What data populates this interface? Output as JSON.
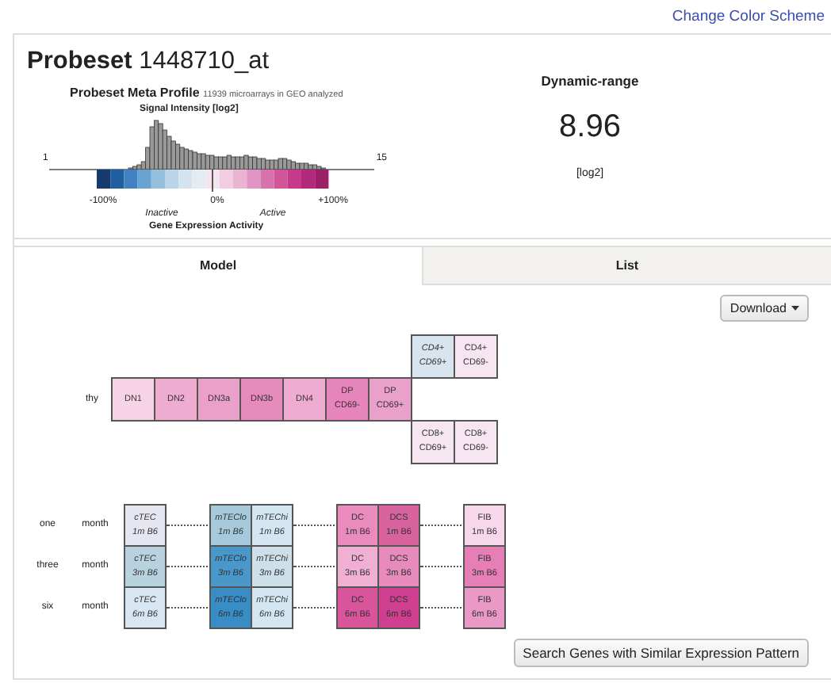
{
  "link": "Change Color Scheme",
  "probeset": {
    "label": "Probeset",
    "id": "1448710_at"
  },
  "meta_profile": {
    "title": "Probeset Meta Profile",
    "subtitle": "11939 microarrays in GEO analyzed",
    "histogram_title": "Signal Intensity [log2]",
    "axis_min": "1",
    "axis_max": "15",
    "scale_labels": [
      "-100%",
      "0%",
      "+100%"
    ],
    "inactive": "Inactive",
    "active": "Active",
    "caption": "Gene Expression Activity"
  },
  "dynamic_range": {
    "title": "Dynamic-range",
    "value": "8.96",
    "unit": "[log2]"
  },
  "tabs": [
    {
      "label": "Model",
      "selected": true
    },
    {
      "label": "List",
      "selected": false
    }
  ],
  "download": "Download",
  "thymus": {
    "label": "thy",
    "upper": [
      {
        "lines": [
          "CD4+",
          "CD69+"
        ],
        "italic": true,
        "color": "#d8e5ee"
      },
      {
        "lines": [
          "CD4+",
          "CD69-"
        ],
        "italic": false,
        "color": "#f6e6f1"
      }
    ],
    "main": [
      {
        "lines": [
          "DN1"
        ],
        "italic": false,
        "color": "#f7d3e6"
      },
      {
        "lines": [
          "DN2"
        ],
        "italic": false,
        "color": "#eeadd0"
      },
      {
        "lines": [
          "DN3a"
        ],
        "italic": false,
        "color": "#eaa1c9"
      },
      {
        "lines": [
          "DN3b"
        ],
        "italic": false,
        "color": "#e68bbb"
      },
      {
        "lines": [
          "DN4"
        ],
        "italic": false,
        "color": "#eeadd0"
      },
      {
        "lines": [
          "DP",
          "CD69-"
        ],
        "italic": false,
        "color": "#e685bb"
      },
      {
        "lines": [
          "DP",
          "CD69+"
        ],
        "italic": false,
        "color": "#eaa1c9"
      }
    ],
    "lower": [
      {
        "lines": [
          "CD8+",
          "CD69+"
        ],
        "italic": false,
        "color": "#f6e6f1"
      },
      {
        "lines": [
          "CD8+",
          "CD69-"
        ],
        "italic": false,
        "color": "#f6e6f1"
      }
    ]
  },
  "stroma": [
    {
      "label": "one",
      "unit": "month",
      "groups": [
        [
          {
            "lines": [
              "cTEC",
              "1m B6"
            ],
            "italic": true,
            "color": "#e6e6f0"
          }
        ],
        [
          {
            "lines": [
              "mTEClo",
              "1m B6"
            ],
            "italic": true,
            "color": "#a7c9dc"
          },
          {
            "lines": [
              "mTEChi",
              "1m B6"
            ],
            "italic": true,
            "color": "#d4e6f2"
          }
        ],
        [
          {
            "lines": [
              "DC",
              "1m B6"
            ],
            "italic": false,
            "color": "#e98bbd"
          },
          {
            "lines": [
              "DCS",
              "1m B6"
            ],
            "italic": false,
            "color": "#d8649f"
          }
        ],
        [
          {
            "lines": [
              "FIB",
              "1m B6"
            ],
            "italic": false,
            "color": "#f7d7ea"
          }
        ]
      ]
    },
    {
      "label": "three",
      "unit": "month",
      "groups": [
        [
          {
            "lines": [
              "cTEC",
              "3m B6"
            ],
            "italic": true,
            "color": "#b8d2e0"
          }
        ],
        [
          {
            "lines": [
              "mTEClo",
              "3m B6"
            ],
            "italic": true,
            "color": "#4a97c9"
          },
          {
            "lines": [
              "mTEChi",
              "3m B6"
            ],
            "italic": true,
            "color": "#cddfe8"
          }
        ],
        [
          {
            "lines": [
              "DC",
              "3m B6"
            ],
            "italic": false,
            "color": "#efb0d3"
          },
          {
            "lines": [
              "DCS",
              "3m B6"
            ],
            "italic": false,
            "color": "#e68bbb"
          }
        ],
        [
          {
            "lines": [
              "FIB",
              "3m B6"
            ],
            "italic": false,
            "color": "#e67fb5"
          }
        ]
      ]
    },
    {
      "label": "six",
      "unit": "month",
      "groups": [
        [
          {
            "lines": [
              "cTEC",
              "6m B6"
            ],
            "italic": true,
            "color": "#d7e6f0"
          }
        ],
        [
          {
            "lines": [
              "mTEClo",
              "6m B6"
            ],
            "italic": true,
            "color": "#3a8cc4"
          },
          {
            "lines": [
              "mTEChi",
              "6m B6"
            ],
            "italic": true,
            "color": "#d4e6f2"
          }
        ],
        [
          {
            "lines": [
              "DC",
              "6m B6"
            ],
            "italic": false,
            "color": "#d8559c"
          },
          {
            "lines": [
              "DCS",
              "6m B6"
            ],
            "italic": false,
            "color": "#cf3f8f"
          }
        ],
        [
          {
            "lines": [
              "FIB",
              "6m B6"
            ],
            "italic": false,
            "color": "#ea99c6"
          }
        ]
      ]
    }
  ],
  "search_button": "Search Genes with Similar Expression Pattern"
}
